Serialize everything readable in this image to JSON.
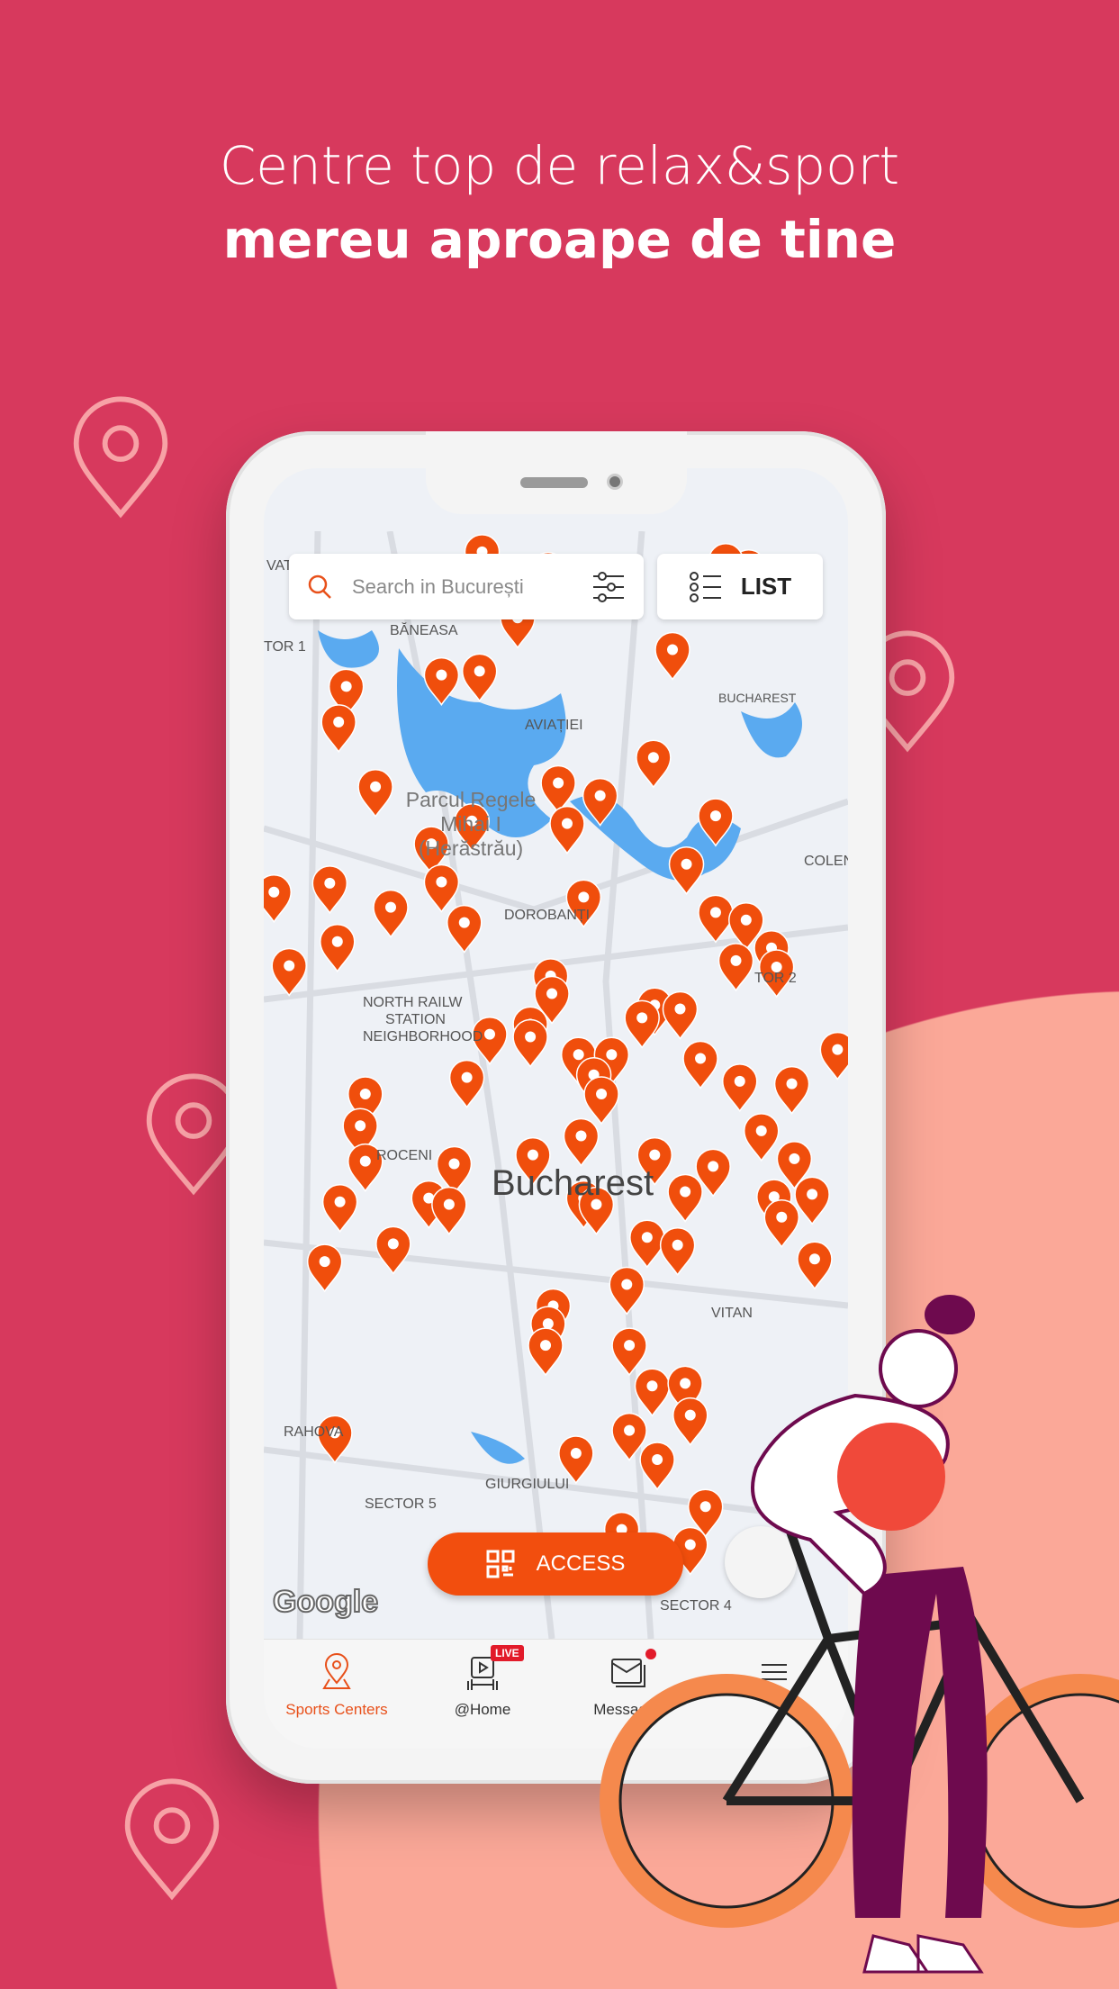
{
  "headline": {
    "line1": "Centre top de relax&sport",
    "line2": "mereu aproape de tine"
  },
  "colors": {
    "background": "#d7395d",
    "accent": "#f24e0e",
    "peach": "#fba898",
    "purple": "#6e0a4e"
  },
  "search": {
    "placeholder": "Search in București",
    "icon": "search-icon",
    "filter_icon": "sliders-icon"
  },
  "list_button": {
    "label": "LIST",
    "icon": "list-icon"
  },
  "map": {
    "labels": {
      "vatra": "VATR",
      "baneasa": "BĂNEASA",
      "sector1": "TOR 1",
      "aviatiei": "AVIAȚIEI",
      "bucharest_top": "BUCHAREST",
      "park1": "Parcul Regele",
      "park2": "Mihai I",
      "park3": "(Herăstrău)",
      "dorobanti": "DOROBANȚI",
      "colentina": "COLEN",
      "sector2": "TOR 2",
      "north1": "NORTH RAILW",
      "north2": "STATION",
      "north3": "NEIGHBORHOOD",
      "city": "Bucharest",
      "croceni": "ROCENI",
      "vitan": "VITAN",
      "rahova": "RAHOVA",
      "giurgiului": "GIURGIULUI",
      "sector5": "SECTOR 5",
      "sector4": "SECTOR 4"
    },
    "attribution": "Google"
  },
  "access_button": {
    "label": "ACCESS",
    "icon": "qr-code-icon"
  },
  "nav": [
    {
      "label": "Sports Centers",
      "icon": "map-pin-icon",
      "active": true
    },
    {
      "label": "@Home",
      "icon": "live-video-icon",
      "badge": "LIVE"
    },
    {
      "label": "Messages",
      "icon": "mail-icon",
      "badge_dot": true
    },
    {
      "icon": "menu-icon"
    }
  ]
}
